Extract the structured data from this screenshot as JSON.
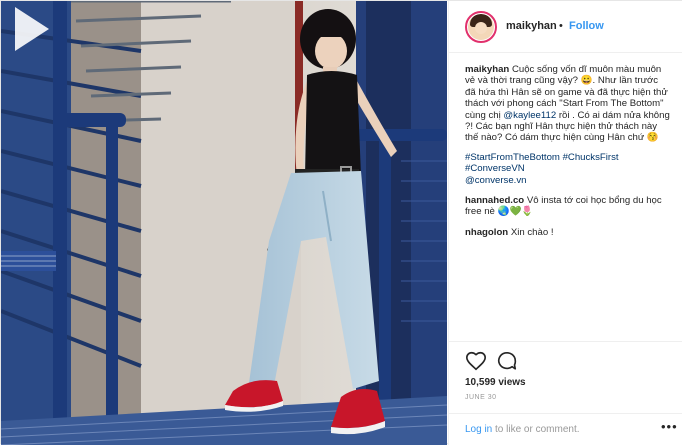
{
  "post": {
    "username": "maikyhan",
    "follow_label": "Follow",
    "header_separator": "•",
    "caption": {
      "username": "maikyhan",
      "text_1": "Cuộc sống vốn dĩ muôn màu muôn vẻ và thời trang cũng vậy? 😀. Như lần trước đã hứa thì Hân sẽ on game và đã thực hiện thử thách với phong cách \"Start From The Bottom\" cùng chị ",
      "mention": "@kaylee112",
      "text_2": " rồi . Có ai dám nửa không ?! Các bạn nghĩ Hân thực hiện thử thách này thế nào? Có dám thực hiện cùng Hân chứ 😚"
    },
    "hashtags": [
      "#StartFromTheBottom",
      "#ChucksFirst",
      "#ConverseVN",
      "@converse.vn"
    ],
    "comments": [
      {
        "username": "hannahed.co",
        "text": " Vô insta tớ coi học bổng du học free nè 🌏💚🌷"
      },
      {
        "username": "nhagolon",
        "text": " Xin chào !"
      }
    ],
    "views": "10,599 views",
    "date": "JUNE 30",
    "login": {
      "link": "Log in",
      "text": " to like or comment."
    },
    "more_label": "•••"
  },
  "icons": {
    "play": "play-icon",
    "heart": "heart-icon",
    "comment": "comment-icon",
    "more": "more-options-icon"
  }
}
